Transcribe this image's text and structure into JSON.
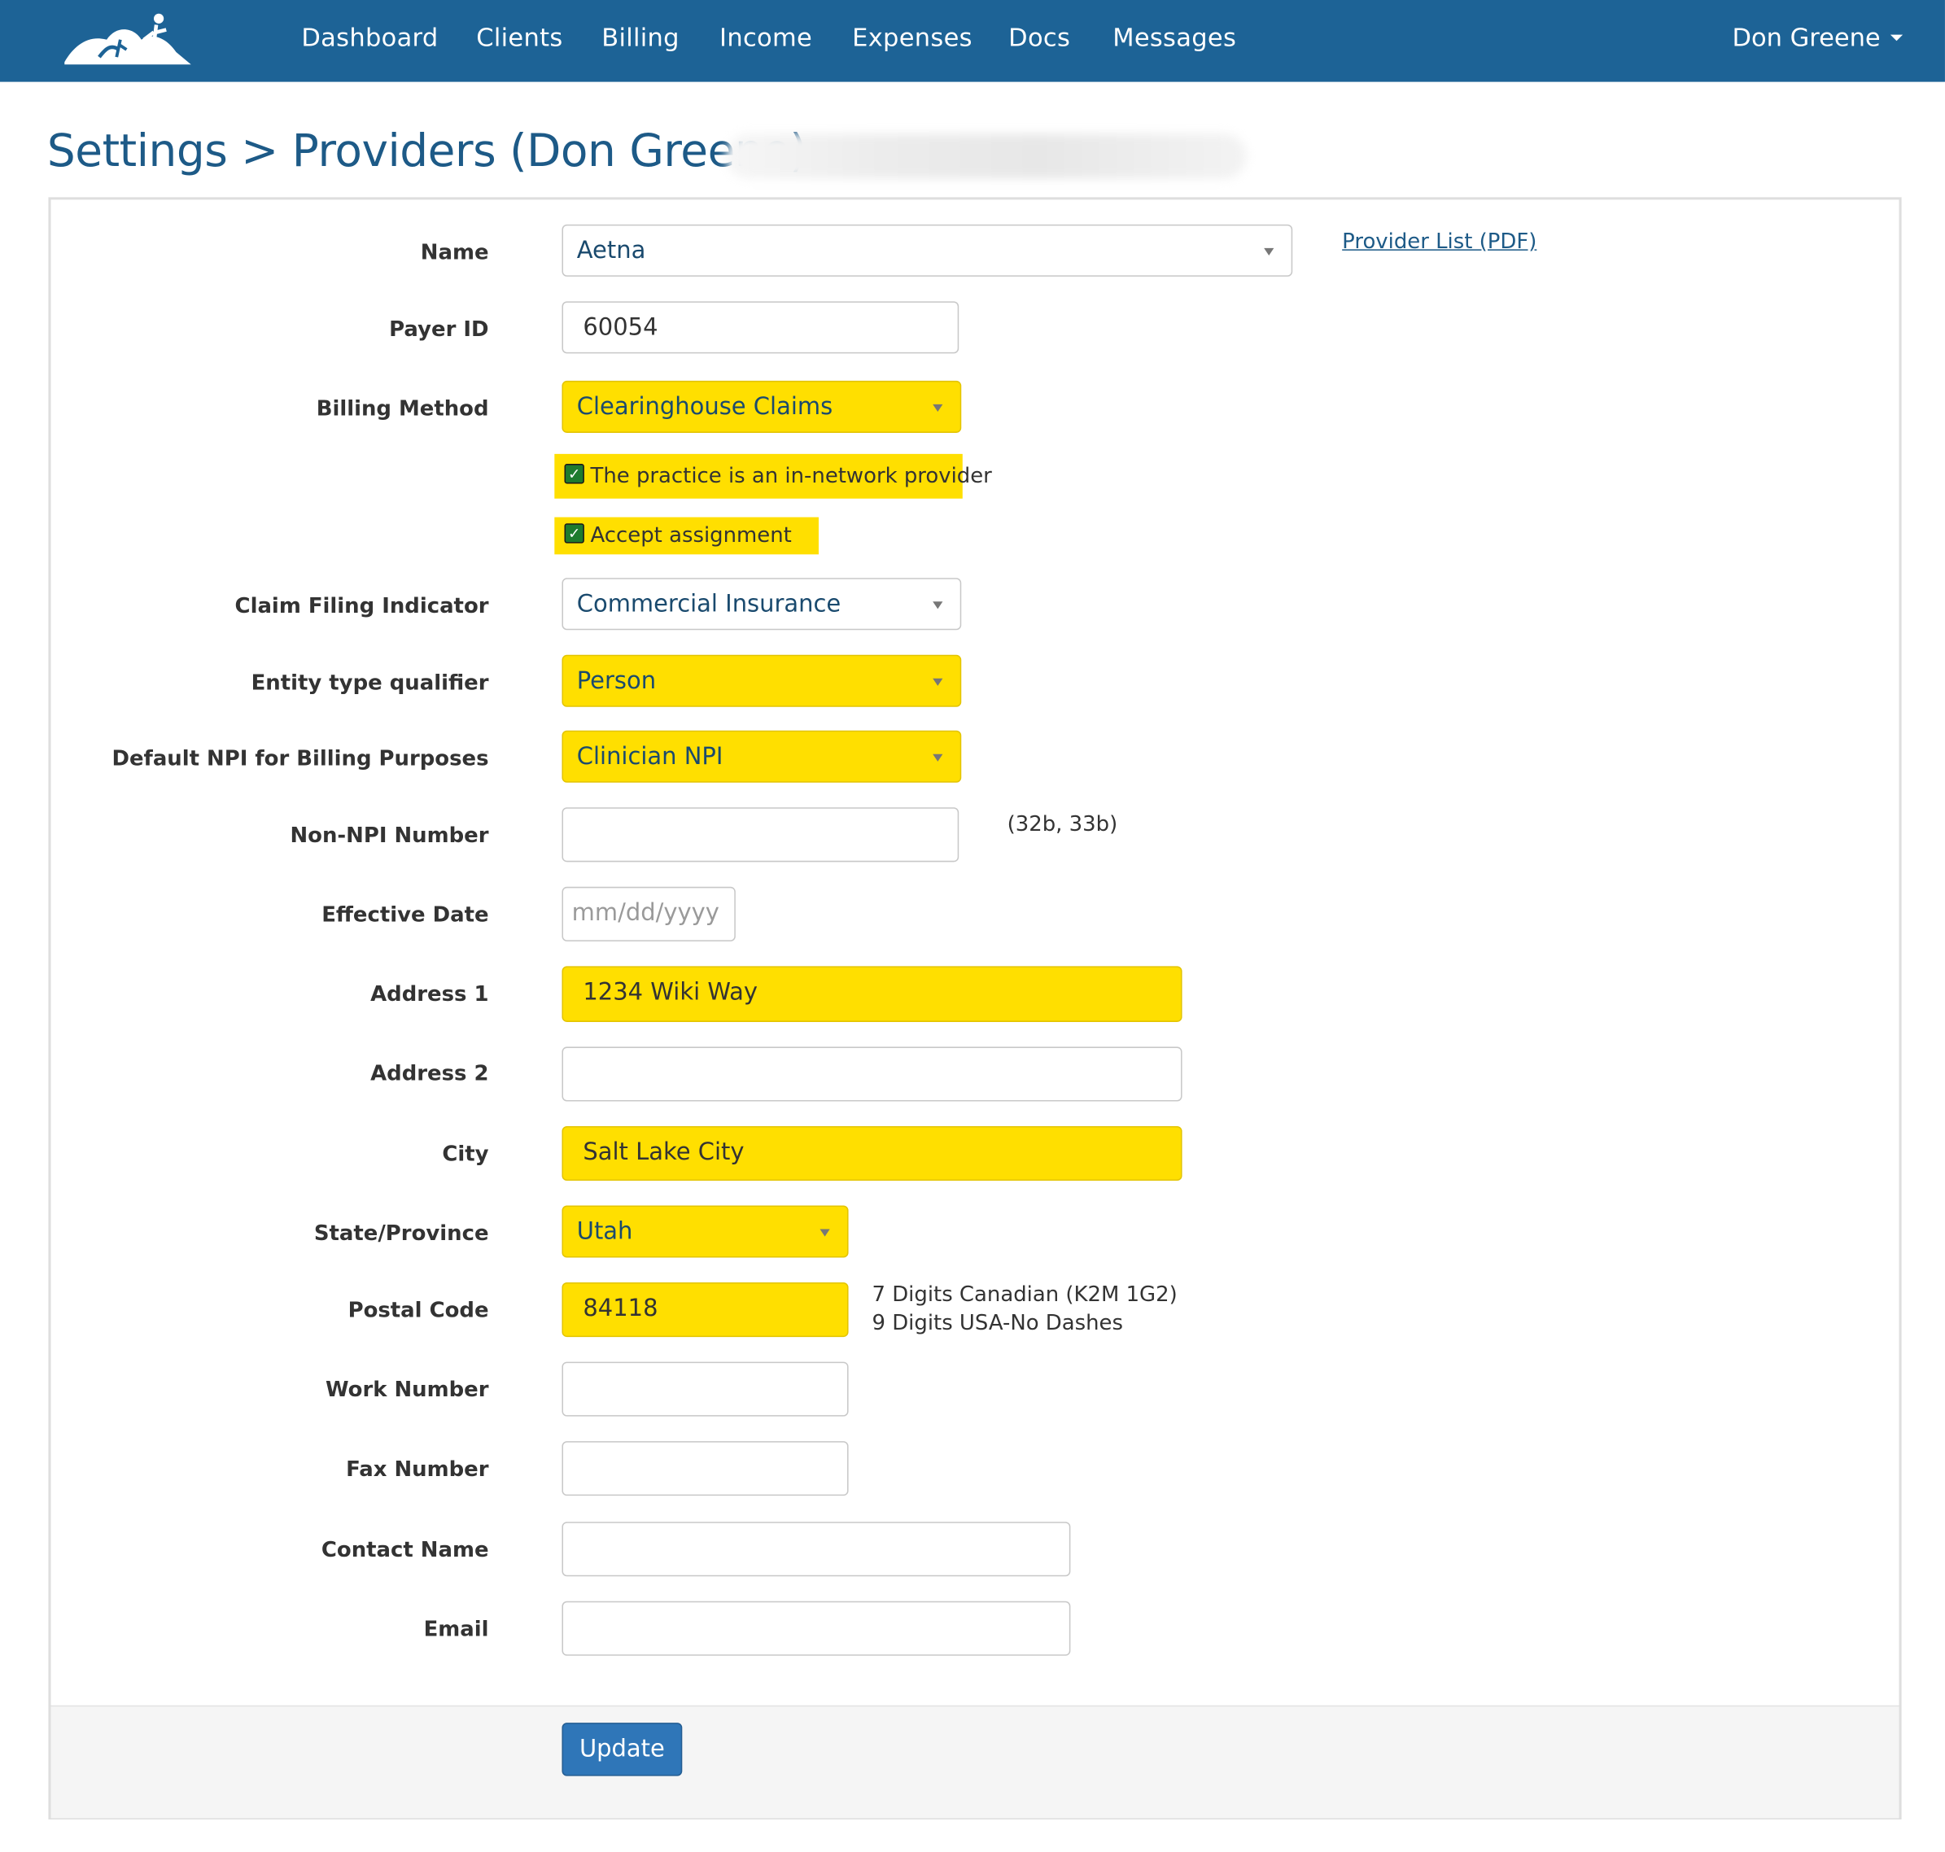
{
  "nav": {
    "items": [
      "Dashboard",
      "Clients",
      "Billing",
      "Income",
      "Expenses",
      "Docs",
      "Messages"
    ],
    "user": "Don Greene"
  },
  "page": {
    "title": "Settings > Providers (Don Greene)"
  },
  "form": {
    "name": {
      "label": "Name",
      "value": "Aetna"
    },
    "provider_list_link": "Provider List (PDF)",
    "payer_id": {
      "label": "Payer ID",
      "value": "60054"
    },
    "billing_method": {
      "label": "Billing Method",
      "value": "Clearinghouse Claims"
    },
    "in_network": {
      "label": "The practice is an in-network provider",
      "checked": true
    },
    "accept_assignment": {
      "label": "Accept assignment",
      "checked": true
    },
    "claim_filing_indicator": {
      "label": "Claim Filing Indicator",
      "value": "Commercial Insurance"
    },
    "entity_type_qualifier": {
      "label": "Entity type qualifier",
      "value": "Person"
    },
    "default_npi": {
      "label": "Default NPI for Billing Purposes",
      "value": "Clinician NPI"
    },
    "non_npi_number": {
      "label": "Non-NPI Number",
      "value": "",
      "hint": "(32b, 33b)"
    },
    "effective_date": {
      "label": "Effective Date",
      "placeholder": "mm/dd/yyyy"
    },
    "address1": {
      "label": "Address 1",
      "value": "1234 Wiki Way"
    },
    "address2": {
      "label": "Address 2",
      "value": ""
    },
    "city": {
      "label": "City",
      "value": "Salt Lake City"
    },
    "state": {
      "label": "State/Province",
      "value": "Utah"
    },
    "postal_code": {
      "label": "Postal Code",
      "value": "84118",
      "hint1": "7 Digits Canadian (K2M 1G2)",
      "hint2": "9 Digits USA-No Dashes"
    },
    "work_number": {
      "label": "Work Number",
      "value": ""
    },
    "fax_number": {
      "label": "Fax Number",
      "value": ""
    },
    "contact_name": {
      "label": "Contact Name",
      "value": ""
    },
    "email": {
      "label": "Email",
      "value": ""
    },
    "update_button": "Update"
  },
  "colors": {
    "navbar": "#1d6396",
    "highlight": "#ffdf00",
    "title": "#1d5a87",
    "button": "#2f76b8"
  }
}
